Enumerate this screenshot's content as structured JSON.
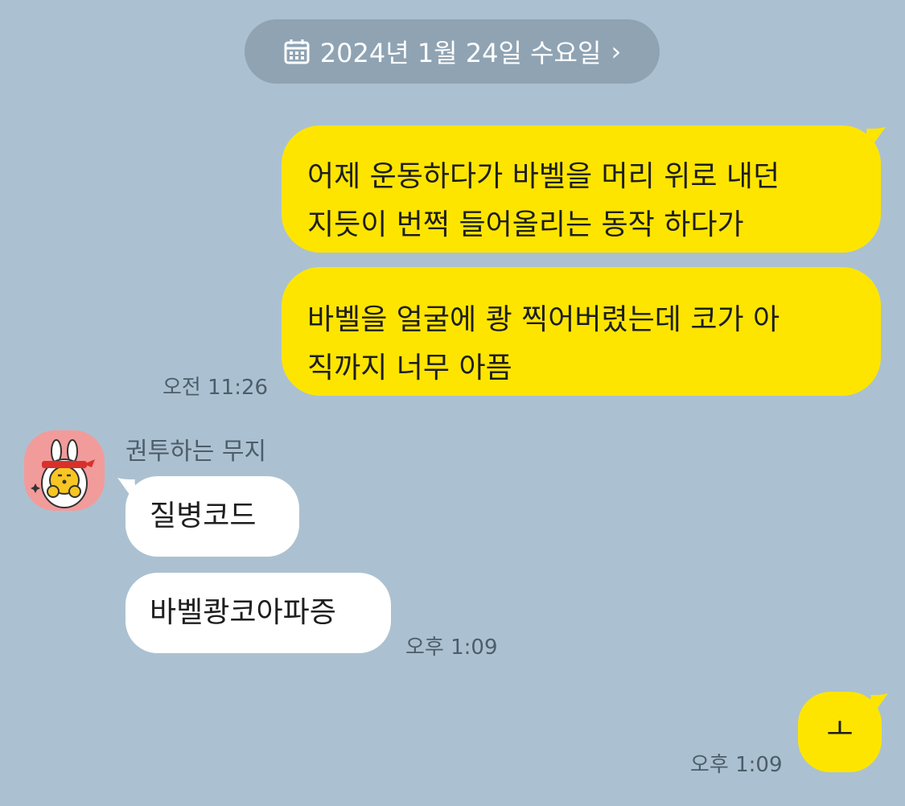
{
  "date_divider": {
    "icon": "calendar-icon",
    "label": "2024년 1월 24일 수요일",
    "chevron": "›"
  },
  "messages": [
    {
      "side": "outgoing",
      "text": "어제 운동하다가 바벨을 머리 위로 내던\n지듯이 번쩍 들어올리는 동작 하다가"
    },
    {
      "side": "outgoing",
      "text": "바벨을 얼굴에 쾅 찍어버렸는데 코가 아\n직까지 너무 아픔",
      "time": "오전 11:26"
    },
    {
      "side": "incoming",
      "sender": "권투하는 무지",
      "text": "질병코드"
    },
    {
      "side": "incoming",
      "text": "바벨쾅코아파증",
      "time": "오후 1:09"
    },
    {
      "side": "outgoing",
      "text": "ㅗ",
      "time": "오후 1:09"
    }
  ],
  "colors": {
    "background": "#abc1d1",
    "outgoing_bubble": "#fee500",
    "incoming_bubble": "#ffffff",
    "date_pill": "#8fa3b3",
    "time_text": "#4d5d6a"
  }
}
